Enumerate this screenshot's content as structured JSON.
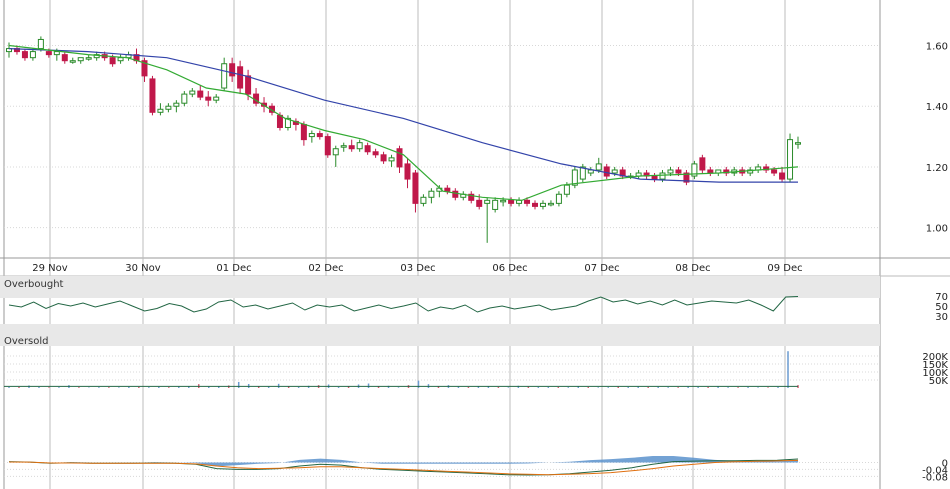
{
  "chart_data": [
    {
      "type": "candlestick",
      "panel": "price",
      "categories": [
        "29 Nov",
        "30 Nov",
        "01 Dec",
        "02 Dec",
        "03 Dec",
        "06 Dec",
        "07 Dec",
        "08 Dec",
        "09 Dec"
      ],
      "y_ticks": [
        "1.60",
        "1.40",
        "1.20",
        "1.00"
      ],
      "ylim": [
        0.9,
        1.75
      ],
      "candles": [
        {
          "o": 1.58,
          "h": 1.61,
          "l": 1.56,
          "c": 1.59
        },
        {
          "o": 1.59,
          "h": 1.6,
          "l": 1.57,
          "c": 1.58
        },
        {
          "o": 1.58,
          "h": 1.59,
          "l": 1.55,
          "c": 1.56
        },
        {
          "o": 1.56,
          "h": 1.59,
          "l": 1.55,
          "c": 1.58
        },
        {
          "o": 1.59,
          "h": 1.63,
          "l": 1.58,
          "c": 1.62
        },
        {
          "o": 1.58,
          "h": 1.59,
          "l": 1.56,
          "c": 1.57
        },
        {
          "o": 1.57,
          "h": 1.59,
          "l": 1.55,
          "c": 1.58
        },
        {
          "o": 1.57,
          "h": 1.58,
          "l": 1.54,
          "c": 1.55
        },
        {
          "o": 1.55,
          "h": 1.56,
          "l": 1.54,
          "c": 1.55
        },
        {
          "o": 1.55,
          "h": 1.56,
          "l": 1.54,
          "c": 1.56
        },
        {
          "o": 1.56,
          "h": 1.57,
          "l": 1.55,
          "c": 1.56
        },
        {
          "o": 1.56,
          "h": 1.58,
          "l": 1.55,
          "c": 1.57
        },
        {
          "o": 1.57,
          "h": 1.58,
          "l": 1.55,
          "c": 1.56
        },
        {
          "o": 1.56,
          "h": 1.57,
          "l": 1.53,
          "c": 1.54
        },
        {
          "o": 1.55,
          "h": 1.57,
          "l": 1.54,
          "c": 1.56
        },
        {
          "o": 1.56,
          "h": 1.58,
          "l": 1.55,
          "c": 1.57
        },
        {
          "o": 1.57,
          "h": 1.59,
          "l": 1.54,
          "c": 1.55
        },
        {
          "o": 1.55,
          "h": 1.56,
          "l": 1.48,
          "c": 1.5
        },
        {
          "o": 1.49,
          "h": 1.5,
          "l": 1.37,
          "c": 1.38
        },
        {
          "o": 1.38,
          "h": 1.41,
          "l": 1.37,
          "c": 1.39
        },
        {
          "o": 1.39,
          "h": 1.41,
          "l": 1.38,
          "c": 1.4
        },
        {
          "o": 1.4,
          "h": 1.42,
          "l": 1.38,
          "c": 1.41
        },
        {
          "o": 1.41,
          "h": 1.45,
          "l": 1.4,
          "c": 1.44
        },
        {
          "o": 1.44,
          "h": 1.46,
          "l": 1.43,
          "c": 1.45
        },
        {
          "o": 1.45,
          "h": 1.47,
          "l": 1.42,
          "c": 1.43
        },
        {
          "o": 1.43,
          "h": 1.45,
          "l": 1.4,
          "c": 1.42
        },
        {
          "o": 1.42,
          "h": 1.44,
          "l": 1.41,
          "c": 1.43
        },
        {
          "o": 1.46,
          "h": 1.56,
          "l": 1.45,
          "c": 1.54
        },
        {
          "o": 1.54,
          "h": 1.56,
          "l": 1.48,
          "c": 1.5
        },
        {
          "o": 1.53,
          "h": 1.55,
          "l": 1.44,
          "c": 1.46
        },
        {
          "o": 1.5,
          "h": 1.52,
          "l": 1.42,
          "c": 1.44
        },
        {
          "o": 1.44,
          "h": 1.46,
          "l": 1.4,
          "c": 1.41
        },
        {
          "o": 1.41,
          "h": 1.43,
          "l": 1.38,
          "c": 1.4
        },
        {
          "o": 1.4,
          "h": 1.41,
          "l": 1.37,
          "c": 1.38
        },
        {
          "o": 1.37,
          "h": 1.38,
          "l": 1.32,
          "c": 1.33
        },
        {
          "o": 1.33,
          "h": 1.37,
          "l": 1.32,
          "c": 1.36
        },
        {
          "o": 1.35,
          "h": 1.36,
          "l": 1.32,
          "c": 1.34
        },
        {
          "o": 1.34,
          "h": 1.35,
          "l": 1.27,
          "c": 1.29
        },
        {
          "o": 1.3,
          "h": 1.32,
          "l": 1.28,
          "c": 1.31
        },
        {
          "o": 1.31,
          "h": 1.32,
          "l": 1.29,
          "c": 1.3
        },
        {
          "o": 1.3,
          "h": 1.31,
          "l": 1.23,
          "c": 1.24
        },
        {
          "o": 1.24,
          "h": 1.27,
          "l": 1.2,
          "c": 1.26
        },
        {
          "o": 1.27,
          "h": 1.28,
          "l": 1.25,
          "c": 1.27
        },
        {
          "o": 1.27,
          "h": 1.29,
          "l": 1.25,
          "c": 1.26
        },
        {
          "o": 1.26,
          "h": 1.29,
          "l": 1.25,
          "c": 1.28
        },
        {
          "o": 1.27,
          "h": 1.28,
          "l": 1.24,
          "c": 1.25
        },
        {
          "o": 1.25,
          "h": 1.26,
          "l": 1.23,
          "c": 1.24
        },
        {
          "o": 1.24,
          "h": 1.25,
          "l": 1.21,
          "c": 1.22
        },
        {
          "o": 1.22,
          "h": 1.24,
          "l": 1.2,
          "c": 1.23
        },
        {
          "o": 1.26,
          "h": 1.27,
          "l": 1.18,
          "c": 1.2
        },
        {
          "o": 1.21,
          "h": 1.23,
          "l": 1.13,
          "c": 1.16
        },
        {
          "o": 1.18,
          "h": 1.19,
          "l": 1.05,
          "c": 1.08
        },
        {
          "o": 1.08,
          "h": 1.11,
          "l": 1.07,
          "c": 1.1
        },
        {
          "o": 1.1,
          "h": 1.13,
          "l": 1.08,
          "c": 1.12
        },
        {
          "o": 1.12,
          "h": 1.14,
          "l": 1.1,
          "c": 1.13
        },
        {
          "o": 1.13,
          "h": 1.14,
          "l": 1.11,
          "c": 1.12
        },
        {
          "o": 1.12,
          "h": 1.13,
          "l": 1.09,
          "c": 1.1
        },
        {
          "o": 1.1,
          "h": 1.12,
          "l": 1.09,
          "c": 1.11
        },
        {
          "o": 1.11,
          "h": 1.12,
          "l": 1.08,
          "c": 1.09
        },
        {
          "o": 1.09,
          "h": 1.11,
          "l": 1.06,
          "c": 1.07
        },
        {
          "o": 1.08,
          "h": 1.1,
          "l": 0.95,
          "c": 1.09
        },
        {
          "o": 1.06,
          "h": 1.1,
          "l": 1.05,
          "c": 1.09
        },
        {
          "o": 1.09,
          "h": 1.1,
          "l": 1.07,
          "c": 1.09
        },
        {
          "o": 1.09,
          "h": 1.1,
          "l": 1.07,
          "c": 1.08
        },
        {
          "o": 1.08,
          "h": 1.1,
          "l": 1.07,
          "c": 1.09
        },
        {
          "o": 1.09,
          "h": 1.1,
          "l": 1.07,
          "c": 1.08
        },
        {
          "o": 1.08,
          "h": 1.09,
          "l": 1.06,
          "c": 1.07
        },
        {
          "o": 1.07,
          "h": 1.09,
          "l": 1.06,
          "c": 1.08
        },
        {
          "o": 1.08,
          "h": 1.09,
          "l": 1.07,
          "c": 1.08
        },
        {
          "o": 1.08,
          "h": 1.12,
          "l": 1.07,
          "c": 1.11
        },
        {
          "o": 1.11,
          "h": 1.15,
          "l": 1.1,
          "c": 1.14
        },
        {
          "o": 1.14,
          "h": 1.2,
          "l": 1.13,
          "c": 1.19
        },
        {
          "o": 1.16,
          "h": 1.21,
          "l": 1.15,
          "c": 1.2
        },
        {
          "o": 1.18,
          "h": 1.2,
          "l": 1.17,
          "c": 1.19
        },
        {
          "o": 1.19,
          "h": 1.23,
          "l": 1.18,
          "c": 1.21
        },
        {
          "o": 1.2,
          "h": 1.21,
          "l": 1.16,
          "c": 1.17
        },
        {
          "o": 1.18,
          "h": 1.2,
          "l": 1.17,
          "c": 1.19
        },
        {
          "o": 1.19,
          "h": 1.2,
          "l": 1.16,
          "c": 1.17
        },
        {
          "o": 1.17,
          "h": 1.18,
          "l": 1.16,
          "c": 1.17
        },
        {
          "o": 1.17,
          "h": 1.19,
          "l": 1.16,
          "c": 1.18
        },
        {
          "o": 1.18,
          "h": 1.19,
          "l": 1.16,
          "c": 1.17
        },
        {
          "o": 1.17,
          "h": 1.18,
          "l": 1.15,
          "c": 1.16
        },
        {
          "o": 1.16,
          "h": 1.19,
          "l": 1.15,
          "c": 1.18
        },
        {
          "o": 1.18,
          "h": 1.2,
          "l": 1.17,
          "c": 1.19
        },
        {
          "o": 1.19,
          "h": 1.2,
          "l": 1.17,
          "c": 1.18
        },
        {
          "o": 1.18,
          "h": 1.19,
          "l": 1.14,
          "c": 1.15
        },
        {
          "o": 1.17,
          "h": 1.22,
          "l": 1.16,
          "c": 1.21
        },
        {
          "o": 1.23,
          "h": 1.24,
          "l": 1.18,
          "c": 1.19
        },
        {
          "o": 1.19,
          "h": 1.2,
          "l": 1.17,
          "c": 1.18
        },
        {
          "o": 1.18,
          "h": 1.19,
          "l": 1.17,
          "c": 1.19
        },
        {
          "o": 1.19,
          "h": 1.2,
          "l": 1.17,
          "c": 1.18
        },
        {
          "o": 1.18,
          "h": 1.2,
          "l": 1.17,
          "c": 1.19
        },
        {
          "o": 1.19,
          "h": 1.2,
          "l": 1.17,
          "c": 1.18
        },
        {
          "o": 1.18,
          "h": 1.2,
          "l": 1.17,
          "c": 1.19
        },
        {
          "o": 1.19,
          "h": 1.21,
          "l": 1.18,
          "c": 1.2
        },
        {
          "o": 1.2,
          "h": 1.21,
          "l": 1.18,
          "c": 1.19
        },
        {
          "o": 1.19,
          "h": 1.2,
          "l": 1.17,
          "c": 1.18
        },
        {
          "o": 1.18,
          "h": 1.2,
          "l": 1.15,
          "c": 1.16
        },
        {
          "o": 1.16,
          "h": 1.31,
          "l": 1.15,
          "c": 1.29
        },
        {
          "o": 1.28,
          "h": 1.3,
          "l": 1.26,
          "c": 1.28
        }
      ],
      "series": [
        {
          "name": "",
          "color": "#3344aa",
          "x": [
            0,
            0.1,
            0.2,
            0.3,
            0.4,
            0.5,
            0.6,
            0.7,
            0.8,
            0.9,
            1.0
          ],
          "values": [
            1.59,
            1.58,
            1.56,
            1.5,
            1.42,
            1.36,
            1.28,
            1.21,
            1.16,
            1.15,
            1.15
          ]
        },
        {
          "name": "",
          "color": "#33aa33",
          "x": [
            0,
            0.1,
            0.15,
            0.2,
            0.25,
            0.3,
            0.35,
            0.4,
            0.45,
            0.5,
            0.55,
            0.6,
            0.65,
            0.7,
            0.8,
            0.9,
            1.0
          ],
          "values": [
            1.6,
            1.57,
            1.56,
            1.52,
            1.46,
            1.44,
            1.36,
            1.32,
            1.29,
            1.24,
            1.12,
            1.1,
            1.09,
            1.14,
            1.17,
            1.18,
            1.2
          ]
        }
      ]
    },
    {
      "type": "line",
      "panel": "oscillator",
      "labels": {
        "top": "Overbought",
        "bottom": "Oversold"
      },
      "y_ticks": [
        "70",
        "50",
        "30"
      ],
      "ylim": [
        10,
        90
      ],
      "series": [
        {
          "name": "",
          "color": "#226644",
          "values": [
            52,
            48,
            58,
            45,
            55,
            50,
            56,
            48,
            54,
            60,
            50,
            40,
            45,
            55,
            50,
            38,
            44,
            58,
            62,
            48,
            52,
            44,
            50,
            56,
            42,
            52,
            48,
            52,
            40,
            46,
            52,
            45,
            50,
            56,
            40,
            48,
            44,
            52,
            38,
            46,
            50,
            44,
            48,
            52,
            42,
            46,
            50,
            60,
            68,
            58,
            62,
            54,
            60,
            52,
            62,
            52,
            56,
            60,
            58,
            56,
            62,
            52,
            40,
            68,
            69
          ]
        }
      ]
    },
    {
      "type": "bar",
      "panel": "volume",
      "y_ticks": [
        "200K",
        "150K",
        "100K",
        "50K"
      ],
      "ylim": [
        0,
        250
      ],
      "values": [
        6,
        6,
        16,
        6,
        4,
        5,
        18,
        5,
        3,
        5,
        5,
        4,
        7,
        6,
        5,
        7,
        5,
        8,
        9,
        24,
        8,
        10,
        16,
        38,
        25,
        12,
        8,
        26,
        12,
        6,
        14,
        18,
        22,
        6,
        10,
        22,
        28,
        12,
        14,
        4,
        18,
        46,
        24,
        12,
        18,
        8,
        6,
        10,
        12,
        6,
        4,
        14,
        8,
        6,
        6,
        6,
        5,
        10,
        6,
        4,
        5,
        8,
        6,
        8,
        6,
        7,
        5,
        5,
        8,
        6,
        6,
        9,
        5,
        5,
        6,
        4,
        4,
        6,
        230,
        18
      ],
      "reference_line": 10
    },
    {
      "type": "line",
      "panel": "macd",
      "y_ticks": [
        "0",
        "-0.04",
        "-0.08"
      ],
      "ylim": [
        -0.095,
        0.02
      ],
      "series": [
        {
          "name": "",
          "color": "#226644",
          "values": [
            0.005,
            0.002,
            -0.005,
            -0.002,
            -0.004,
            -0.004,
            -0.005,
            -0.003,
            -0.005,
            -0.01,
            -0.035,
            -0.04,
            -0.04,
            -0.035,
            -0.02,
            -0.01,
            -0.015,
            -0.03,
            -0.04,
            -0.045,
            -0.05,
            -0.055,
            -0.06,
            -0.065,
            -0.07,
            -0.072,
            -0.07,
            -0.065,
            -0.055,
            -0.045,
            -0.03,
            -0.01,
            0.005,
            0.008,
            0.01,
            0.01,
            0.012,
            0.013,
            0.02
          ]
        },
        {
          "name": "",
          "color": "#e07010",
          "values": [
            0.003,
            0.002,
            -0.003,
            -0.003,
            -0.004,
            -0.004,
            -0.004,
            -0.004,
            -0.005,
            -0.008,
            -0.02,
            -0.03,
            -0.035,
            -0.033,
            -0.03,
            -0.025,
            -0.025,
            -0.03,
            -0.035,
            -0.04,
            -0.045,
            -0.05,
            -0.055,
            -0.06,
            -0.065,
            -0.068,
            -0.07,
            -0.068,
            -0.064,
            -0.058,
            -0.048,
            -0.035,
            -0.02,
            -0.01,
            0.0,
            0.004,
            0.007,
            0.009,
            0.012
          ]
        }
      ],
      "histogram_color": "#5a92cc"
    }
  ]
}
